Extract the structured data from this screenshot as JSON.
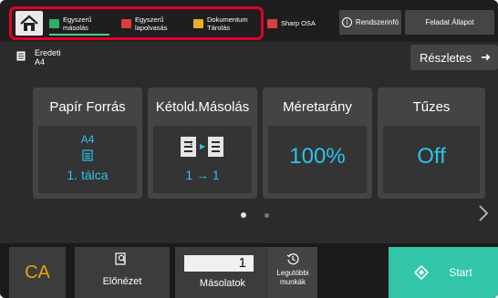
{
  "header": {
    "shortcuts": [
      {
        "label": "Egyszerű másolás",
        "line1": "Egyszerű",
        "line2": "másolás",
        "color": "#2fae6b"
      },
      {
        "label": "Egyszerű lapolvasás",
        "line1": "Egyszerű",
        "line2": "lapolvasás",
        "color": "#e23b3b"
      },
      {
        "label": "Dokumentum Tárolás",
        "line1": "Dokumentum",
        "line2": "Tárolás",
        "color": "#e8b020"
      },
      {
        "label": "Sharp OSA",
        "line1": "Sharp OSA",
        "color": "#d94040"
      }
    ],
    "system_info": "Rendszerinfó",
    "job_status": "Feladat Állapot"
  },
  "original": {
    "label": "Eredeti",
    "value": "A4"
  },
  "details": {
    "label": "Részletes"
  },
  "tiles": {
    "paper_source": {
      "title": "Papír Forrás",
      "paper_size": "A4",
      "tray": "1. tálca"
    },
    "duplex": {
      "title": "Kétold.Másolás",
      "value": "1 → 1"
    },
    "ratio": {
      "title": "Méretarány",
      "value": "100%"
    },
    "staple": {
      "title": "Tűzes",
      "value": "Off"
    }
  },
  "bottom": {
    "ca": "CA",
    "preview": "Előnézet",
    "copies_label": "Másolatok",
    "copies_value": "1",
    "recent_line1": "Legutóbbi",
    "recent_line2": "munkák",
    "start": "Start"
  },
  "colors": {
    "accent_cyan": "#2bc4ec",
    "start_green": "#33c5a7",
    "ca_orange": "#e8a20a",
    "highlight_red": "#e0002a"
  }
}
